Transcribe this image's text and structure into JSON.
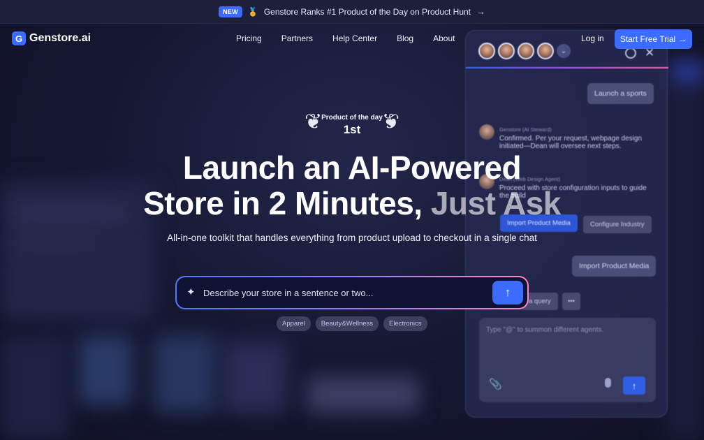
{
  "announcement": {
    "badge": "NEW",
    "medal_icon": "medal-icon",
    "text": "Genstore Ranks #1 Product of the Day on Product Hunt",
    "arrow": "→"
  },
  "nav": {
    "logo_letter": "G",
    "logo_text": "Genstore.ai",
    "links": [
      "Pricing",
      "Partners",
      "Help Center",
      "Blog",
      "About"
    ],
    "login": "Log in",
    "cta": "Start Free Trial",
    "cta_arrow": "→"
  },
  "award": {
    "line1": "Product of the day",
    "line2": "1st"
  },
  "hero": {
    "headline_line1": "Launch an AI-Powered",
    "headline_line2_main": "Store in 2 Minutes, ",
    "headline_line2_fade": "Just Ask",
    "subhead": "All-in-one toolkit that handles everything from product upload to checkout in a single chat"
  },
  "search": {
    "placeholder": "Describe your store in a sentence or two...",
    "value": "",
    "submit_icon": "arrow-up-icon",
    "tags": [
      "Apparel",
      "Beauty&Wellness",
      "Electronics"
    ]
  },
  "chat_panel": {
    "user_msg_1": "Launch a sports",
    "agent1_name": "Genstore (AI Steward)",
    "agent1_msg": "Confirmed. Per your request, webpage design initiated—Dean will oversee next steps.",
    "agent2_name": "Dean (Web Design Agent)",
    "agent2_msg": "Proceed with store configuration inputs to guide the build",
    "chip_primary": "Import Product Media",
    "chip_secondary": "Configure Industry",
    "user_msg_2": "Import Product Media",
    "query_chip": "a query",
    "more": "•••",
    "composer_placeholder": "Type \"@\" to summon different agents.",
    "avatar_count": 4
  },
  "colors": {
    "accent": "#3b6cff",
    "background": "#15172b",
    "gradient_pink": "#ff87c4"
  }
}
